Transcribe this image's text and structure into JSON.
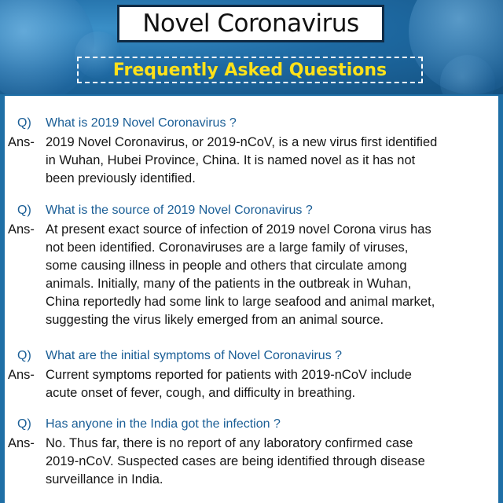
{
  "header": {
    "title": "Novel Coronavirus",
    "subtitle": "Frequently Asked Questions"
  },
  "colors": {
    "background_blue": "#1f6fa6",
    "question_blue": "#1a5e96",
    "subtitle_yellow": "#ffe11a",
    "answer_text": "#161616"
  },
  "faq": [
    {
      "q_marker": "Q)",
      "question": "What is 2019 Novel Coronavirus ?",
      "a_marker": "Ans-",
      "answer_lines": [
        "2019 Novel Coronavirus, or 2019-nCoV, is a new virus first identified",
        "in Wuhan, Hubei Province, China. It is named novel as it has not",
        "been previously identified."
      ]
    },
    {
      "q_marker": "Q)",
      "question": "What is the source of 2019 Novel Coronavirus ?",
      "a_marker": "Ans-",
      "answer_lines": [
        "At present exact source of infection of 2019 novel Corona virus has",
        "not been identified. Coronaviruses are a large family of viruses,",
        "some causing illness in people and others that circulate among",
        "animals. Initially, many of the patients in the outbreak in Wuhan,",
        "China reportedly had some link to large seafood and animal market,",
        "suggesting the virus likely emerged from an animal source."
      ]
    },
    {
      "q_marker": "Q)",
      "question": "What are the initial symptoms of Novel Coronavirus ?",
      "a_marker": "Ans-",
      "answer_lines": [
        "Current symptoms reported for patients with 2019-nCoV include",
        "acute onset of fever, cough, and difficulty in breathing."
      ]
    },
    {
      "q_marker": "Q)",
      "question": "Has anyone in the India got the infection ?",
      "a_marker": "Ans-",
      "answer_lines": [
        "No. Thus far, there is no report of any laboratory confirmed case",
        "2019-nCoV.  Suspected cases are being  identified through disease",
        "surveillance in India."
      ]
    }
  ]
}
